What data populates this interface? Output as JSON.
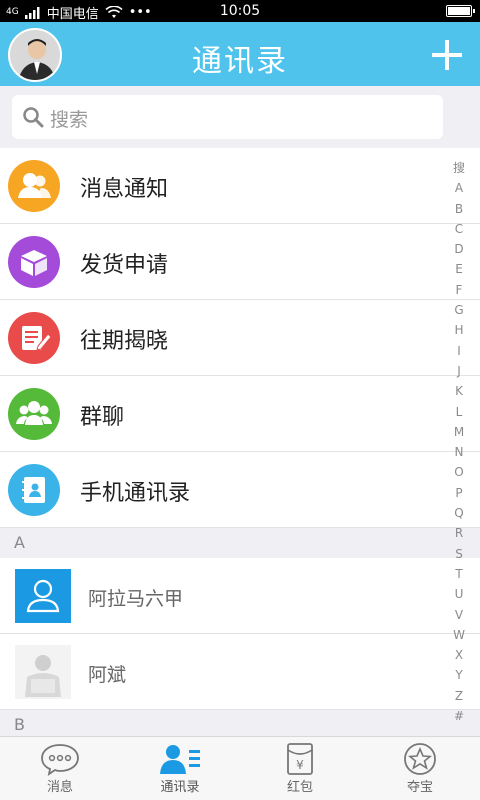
{
  "status_bar": {
    "network": "4G",
    "carrier": "中国电信",
    "time": "10:05"
  },
  "header": {
    "title": "通讯录",
    "add_icon": "plus-icon"
  },
  "search": {
    "placeholder": "搜索"
  },
  "menu": [
    {
      "label": "消息通知",
      "icon": "people-icon",
      "color": "#f6a623"
    },
    {
      "label": "发货申请",
      "icon": "box-icon",
      "color": "#a44bd9"
    },
    {
      "label": "往期揭晓",
      "icon": "edit-note-icon",
      "color": "#e94a4a"
    },
    {
      "label": "群聊",
      "icon": "group-icon",
      "color": "#55b93a"
    },
    {
      "label": "手机通讯录",
      "icon": "contact-book-icon",
      "color": "#3ab4e8"
    }
  ],
  "sections": [
    {
      "letter": "A",
      "contacts": [
        {
          "name": "阿拉马六甲",
          "avatar": "default-avatar"
        },
        {
          "name": "阿斌",
          "avatar": "photo-avatar"
        }
      ]
    },
    {
      "letter": "B",
      "contacts": []
    }
  ],
  "index_bar": [
    "搜",
    "A",
    "B",
    "C",
    "D",
    "E",
    "F",
    "G",
    "H",
    "I",
    "J",
    "K",
    "L",
    "M",
    "N",
    "O",
    "P",
    "Q",
    "R",
    "S",
    "T",
    "U",
    "V",
    "W",
    "X",
    "Y",
    "Z",
    "#"
  ],
  "tabs": [
    {
      "label": "消息",
      "icon": "chat-bubble-icon",
      "active": false
    },
    {
      "label": "通讯录",
      "icon": "contacts-icon",
      "active": true
    },
    {
      "label": "红包",
      "icon": "red-envelope-icon",
      "active": false
    },
    {
      "label": "夺宝",
      "icon": "star-icon",
      "active": false
    }
  ],
  "colors": {
    "header": "#4fc3ec",
    "accent": "#1b9ae3"
  }
}
